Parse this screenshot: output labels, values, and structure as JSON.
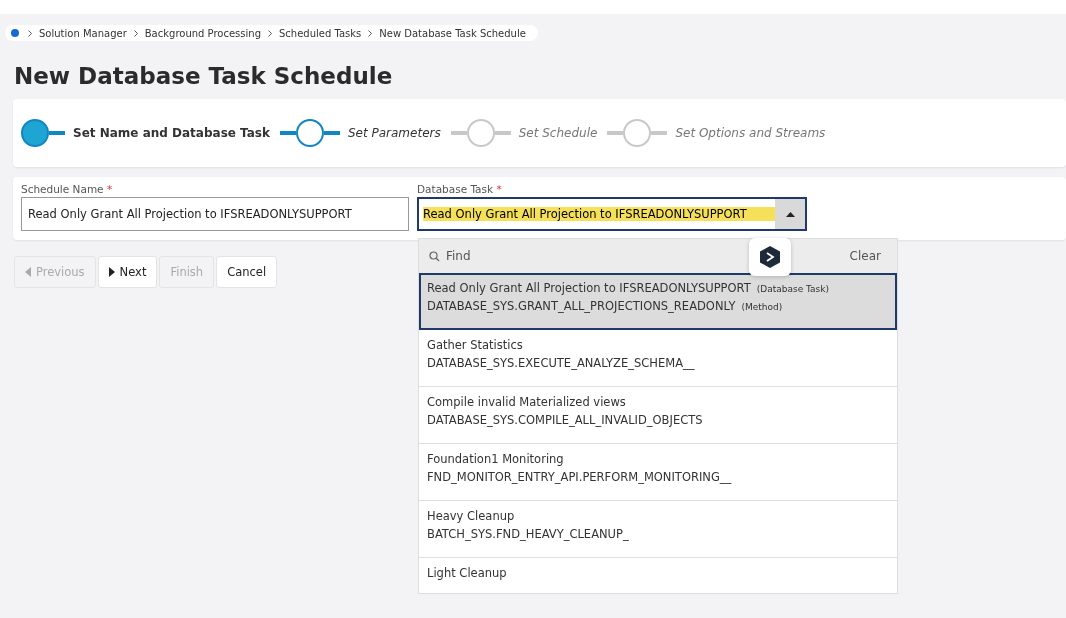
{
  "breadcrumb": [
    "Solution Manager",
    "Background Processing",
    "Scheduled Tasks",
    "New Database Task Schedule"
  ],
  "title": "New Database Task Schedule",
  "steps": [
    {
      "label": "Set Name and Database Task",
      "selected": true,
      "enabled": true
    },
    {
      "label": "Set Parameters",
      "selected": false,
      "enabled": true
    },
    {
      "label": "Set Schedule",
      "selected": false,
      "enabled": false
    },
    {
      "label": "Set Options and Streams",
      "selected": false,
      "enabled": false
    }
  ],
  "fields": [
    {
      "label": "Schedule Name",
      "required_mark": "*",
      "value": "Read Only Grant All Projection to IFSREADONLYSUPPORT",
      "kind": "text"
    },
    {
      "label": "Database Task",
      "required_mark": "*",
      "value": "Read Only Grant All Projection to IFSREADONLYSUPPORT",
      "kind": "lookup",
      "expanded": true
    }
  ],
  "buttons": [
    {
      "label": "Previous",
      "kind": "back",
      "disabled": true
    },
    {
      "label": "Next",
      "kind": "forward",
      "disabled": false
    },
    {
      "label": "Finish",
      "disabled": true
    },
    {
      "label": "Cancel",
      "disabled": false
    }
  ],
  "dropdown": {
    "placeholder": "Find",
    "clear": "Clear",
    "items": [
      {
        "name": "Read Only Grant All Projection to IFSREADONLYSUPPORT",
        "name_tag": "(Database Task)",
        "method": "DATABASE_SYS.GRANT_ALL_PROJECTIONS_READONLY",
        "method_tag": "(Method)",
        "selected": true
      },
      {
        "name": "Gather Statistics",
        "method": "DATABASE_SYS.EXECUTE_ANALYZE_SCHEMA__",
        "selected": false
      },
      {
        "name": "Compile invalid Materialized views",
        "method": "DATABASE_SYS.COMPILE_ALL_INVALID_OBJECTS",
        "selected": false
      },
      {
        "name": "Foundation1 Monitoring",
        "method": "FND_MONITOR_ENTRY_API.PERFORM_MONITORING__",
        "selected": false
      },
      {
        "name": "Heavy Cleanup",
        "method": "BATCH_SYS.FND_HEAVY_CLEANUP_",
        "selected": false
      },
      {
        "name": "Light Cleanup",
        "selected": false
      }
    ]
  }
}
